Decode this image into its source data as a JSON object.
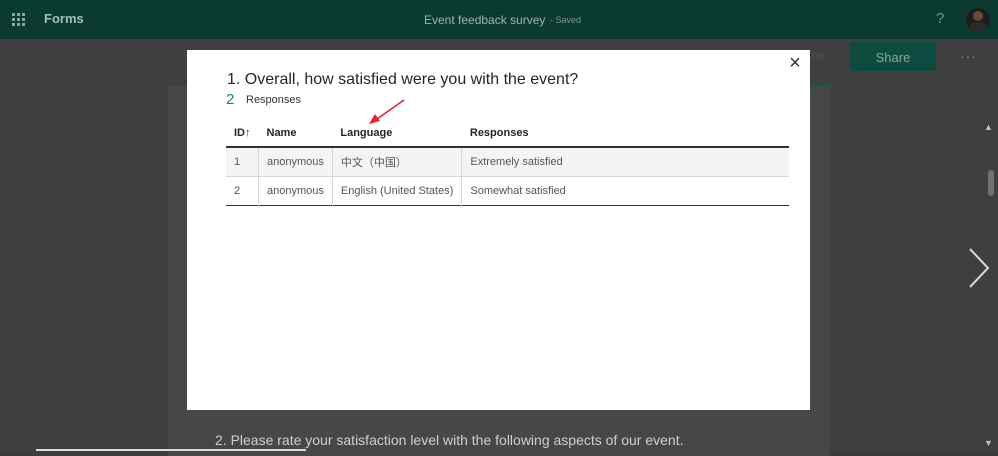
{
  "topbar": {
    "app_name": "Forms",
    "doc_title": "Event feedback survey",
    "doc_saved": "- Saved",
    "help": "?"
  },
  "toolbar": {
    "tab_partial": "ne",
    "share_label": "Share",
    "more_label": "···"
  },
  "background": {
    "question2": "2.  Please rate your satisfaction level with the following aspects of our event."
  },
  "modal": {
    "close": "×",
    "question_title": "1. Overall, how satisfied were you with the event?",
    "response_count": "2",
    "response_label": "Responses",
    "table": {
      "headers": {
        "id": "ID",
        "sort_icon": "↑",
        "name": "Name",
        "language": "Language",
        "responses": "Responses"
      },
      "rows": [
        {
          "id": "1",
          "name": "anonymous",
          "language": "中文（中国）",
          "response": "Extremely satisfied"
        },
        {
          "id": "2",
          "name": "anonymous",
          "language": "English (United States)",
          "response": "Somewhat satisfied"
        }
      ]
    }
  },
  "colors": {
    "accent": "#108a72",
    "topbar": "#0b3a31",
    "annotation": "#e8212a"
  }
}
